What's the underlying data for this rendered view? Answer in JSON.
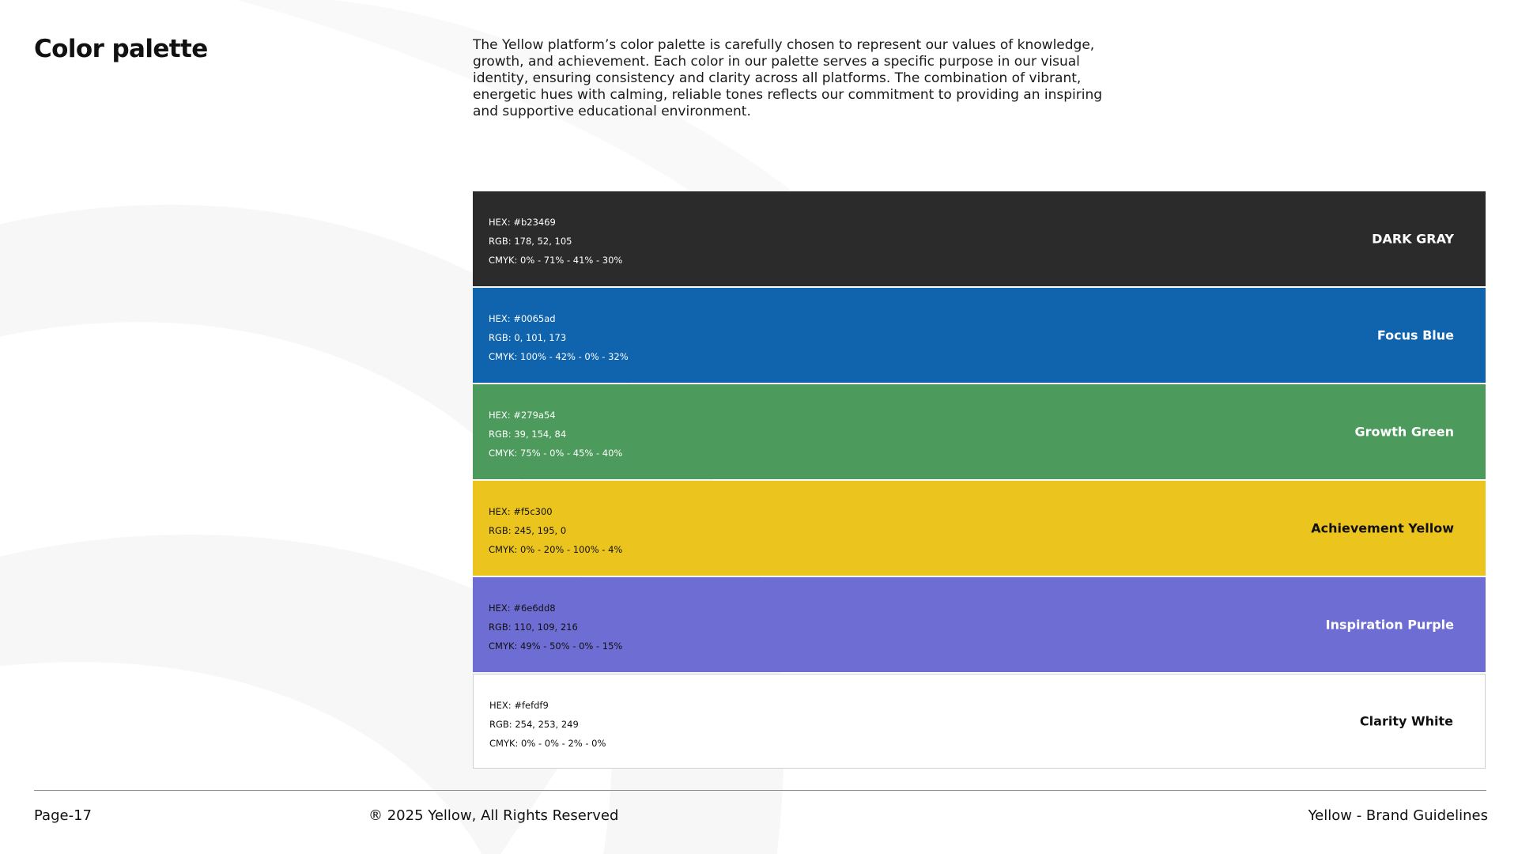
{
  "page": {
    "title": "Color palette",
    "intro": "The Yellow platform’s color palette is carefully chosen to represent our values of knowledge, growth, and achievement. Each color in our palette serves a specific purpose in our visual identity, ensuring consistency and clarity across all platforms. The combination of vibrant, energetic hues with calming, reliable tones reflects our commitment to providing an inspiring and supportive educational environment."
  },
  "swatches": [
    {
      "hex": "HEX: #b23469",
      "rgb": "RGB: 178, 52, 105",
      "cmyk": "CMYK: 0% - 71% - 41% - 30%",
      "name": "DARK GRAY",
      "fill": "#2b2b2b"
    },
    {
      "hex": "HEX: #0065ad",
      "rgb": "RGB: 0, 101, 173",
      "cmyk": "CMYK: 100% - 42% - 0% - 32%",
      "name": "Focus Blue",
      "fill": "#1064ad"
    },
    {
      "hex": "HEX: #279a54",
      "rgb": "RGB: 39, 154, 84",
      "cmyk": "CMYK: 75% - 0% - 45% - 40%",
      "name": "Growth Green",
      "fill": "#4c9a5c"
    },
    {
      "hex": "HEX: #f5c300",
      "rgb": "RGB: 245, 195, 0",
      "cmyk": "CMYK: 0% - 20% - 100% - 4%",
      "name": "Achievement Yellow",
      "fill": "#ebc41e"
    },
    {
      "hex": "HEX: #6e6dd8",
      "rgb": "RGB: 110, 109, 216",
      "cmyk": "CMYK: 49% - 50% - 0% - 15%",
      "name": "Inspiration Purple",
      "fill": "#6e6dd3"
    },
    {
      "hex": "HEX: #fefdf9",
      "rgb": "RGB: 254, 253, 249",
      "cmyk": "CMYK: 0% - 0% - 2% - 0%",
      "name": "Clarity White",
      "fill": "#ffffff"
    }
  ],
  "footer": {
    "page_number": "Page-17",
    "copyright": "® 2025 Yellow, All Rights Reserved",
    "doc_title": "Yellow - Brand Guidelines"
  }
}
